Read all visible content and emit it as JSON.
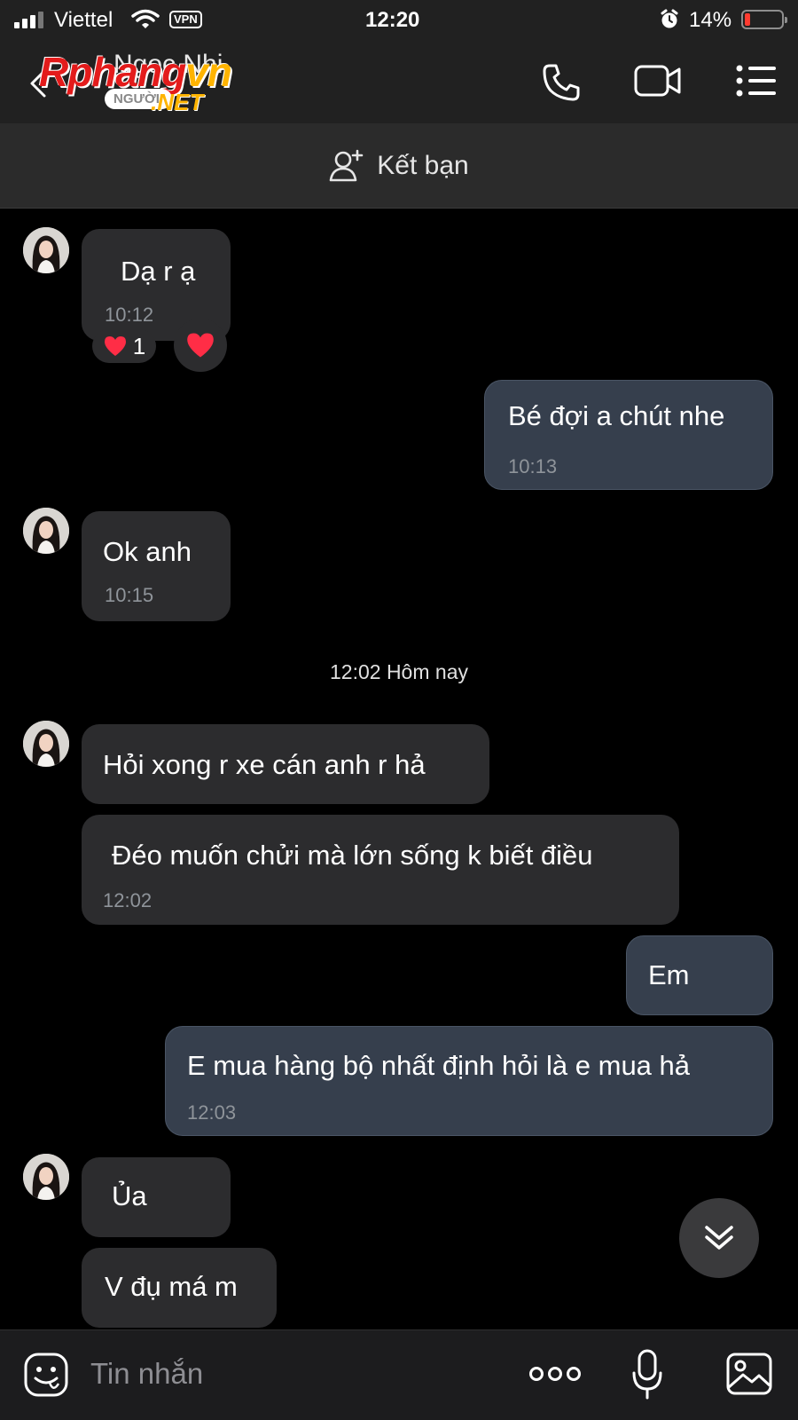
{
  "status_bar": {
    "carrier": "Viettel",
    "vpn": "VPN",
    "time": "12:20",
    "battery_percent": "14%",
    "battery_level": 0.14,
    "icons": [
      "signal-icon",
      "wifi-icon",
      "alarm-icon",
      "battery-icon"
    ]
  },
  "header": {
    "contact_name": "Ngọc Nhi",
    "watermark": {
      "main": "Rphang",
      "accent": "vn",
      "sub": "NGƯỜI",
      "net": ".NET"
    },
    "icons": [
      "back-icon",
      "phone-icon",
      "video-call-icon",
      "menu-icon"
    ]
  },
  "add_friend": {
    "label": "Kết bạn"
  },
  "messages": [
    {
      "direction": "in",
      "text": "Dạ r ạ",
      "time": "10:12"
    },
    {
      "direction": "out",
      "text": "Bé đợi a chút nhe",
      "time": "10:13"
    },
    {
      "direction": "in",
      "text": "Ok anh",
      "time": "10:15"
    },
    {
      "direction": "in",
      "text": "Hỏi xong r xe cán anh r hả",
      "time": ""
    },
    {
      "direction": "in",
      "text": "Đéo muốn chửi mà lớn sống k biết điều",
      "time": "12:02"
    },
    {
      "direction": "out",
      "text": "Em",
      "time": ""
    },
    {
      "direction": "out",
      "text": "E mua hàng bộ nhất định hỏi là e mua hả",
      "time": "12:03"
    },
    {
      "direction": "in",
      "text": "Ủa",
      "time": ""
    },
    {
      "direction": "in",
      "text": "V đụ má m",
      "time": ""
    }
  ],
  "reaction": {
    "emoji": "heart",
    "count": "1"
  },
  "day_separator": "12:02 Hôm nay",
  "composer": {
    "placeholder": "Tin nhắn",
    "icons": [
      "sticker-icon",
      "more-icon",
      "microphone-icon",
      "image-icon"
    ]
  },
  "colors": {
    "background": "#000000",
    "bar": "#212121",
    "incoming_bubble": "#2c2c2e",
    "outgoing_bubble": "#363f4d",
    "timestamp": "#8f949a",
    "heart": "#ff2d46",
    "battery_low": "#ff3b30"
  }
}
